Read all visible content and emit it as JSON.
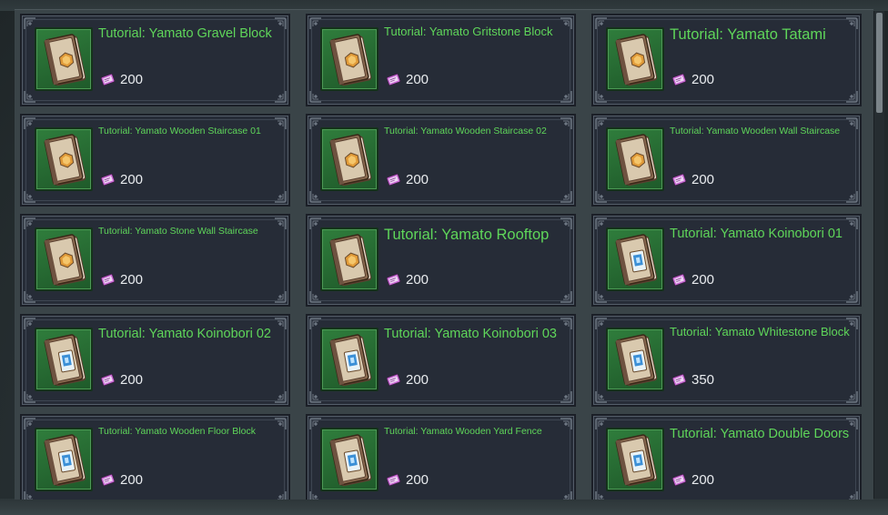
{
  "shop": {
    "items": [
      {
        "name": "Tutorial: Yamato Gravel Block",
        "price": "200",
        "size": "large",
        "icon": "book-hexagon-icon"
      },
      {
        "name": "Tutorial: Yamato Gritstone Block",
        "price": "200",
        "size": "medium",
        "icon": "book-hexagon-icon"
      },
      {
        "name": "Tutorial: Yamato Tatami",
        "price": "200",
        "size": "xlarge",
        "icon": "book-hexagon-icon"
      },
      {
        "name": "Tutorial: Yamato Wooden Staircase 01",
        "price": "200",
        "size": "small",
        "icon": "book-hexagon-icon"
      },
      {
        "name": "Tutorial: Yamato Wooden Staircase 02",
        "price": "200",
        "size": "small",
        "icon": "book-hexagon-icon"
      },
      {
        "name": "Tutorial: Yamato Wooden Wall Staircase",
        "price": "200",
        "size": "small",
        "icon": "book-hexagon-icon"
      },
      {
        "name": "Tutorial: Yamato Stone Wall Staircase",
        "price": "200",
        "size": "small",
        "icon": "book-hexagon-icon"
      },
      {
        "name": "Tutorial: Yamato Rooftop",
        "price": "200",
        "size": "xlarge",
        "icon": "book-hexagon-icon"
      },
      {
        "name": "Tutorial: Yamato Koinobori 01",
        "price": "200",
        "size": "large",
        "icon": "book-blue-card-icon"
      },
      {
        "name": "Tutorial: Yamato Koinobori 02",
        "price": "200",
        "size": "large",
        "icon": "book-blue-card-icon"
      },
      {
        "name": "Tutorial: Yamato Koinobori 03",
        "price": "200",
        "size": "large",
        "icon": "book-blue-card-icon"
      },
      {
        "name": "Tutorial: Yamato Whitestone Block",
        "price": "350",
        "size": "medium",
        "icon": "book-blue-card-icon"
      },
      {
        "name": "Tutorial: Yamato Wooden Floor Block",
        "price": "200",
        "size": "small",
        "icon": "book-blue-card-icon"
      },
      {
        "name": "Tutorial: Yamato Wooden Yard Fence",
        "price": "200",
        "size": "small",
        "icon": "book-blue-card-icon"
      },
      {
        "name": "Tutorial: Yamato Double Doors",
        "price": "200",
        "size": "large",
        "icon": "book-blue-card-icon"
      }
    ],
    "currency_icon": "ticket-icon"
  },
  "colors": {
    "item_name": "#5fd65a",
    "price": "#e9ecef",
    "icon_bg": "#2f7d3c",
    "card_bg": "#262c37"
  }
}
